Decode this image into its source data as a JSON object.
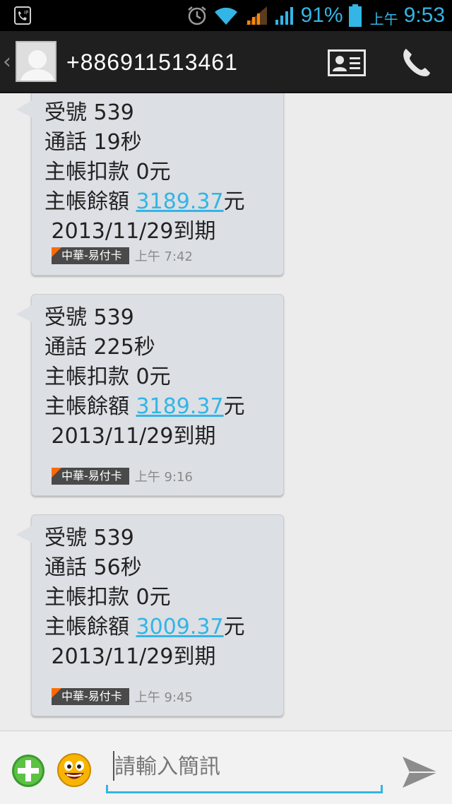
{
  "status_bar": {
    "battery_percent": "91%",
    "clock_prefix": "上午",
    "clock": "9:53",
    "accent": "#33b5e5"
  },
  "header": {
    "contact_number": "+886911513461",
    "avatar_icon": "contact-placeholder-icon",
    "actions": [
      "contact-card-icon",
      "phone-icon"
    ]
  },
  "messages": [
    {
      "line1": "受號 539",
      "line2": "通話 19秒",
      "line3": "主帳扣款 0元",
      "balance_label": "主帳餘額 ",
      "balance_amount": "3189.37",
      "balance_unit": "元",
      "line5": " 2013/11/29到期",
      "sim_label": "中華-易付卡",
      "time": "上午 7:42"
    },
    {
      "line1": "受號 539",
      "line2": "通話 225秒",
      "line3": "主帳扣款 0元",
      "balance_label": "主帳餘額 ",
      "balance_amount": "3189.37",
      "balance_unit": "元",
      "line5": " 2013/11/29到期",
      "sim_label": "中華-易付卡",
      "time": "上午 9:16"
    },
    {
      "line1": "受號 539",
      "line2": "通話 56秒",
      "line3": "主帳扣款 0元",
      "balance_label": "主帳餘額 ",
      "balance_amount": "3009.37",
      "balance_unit": "元",
      "line5": " 2013/11/29到期",
      "sim_label": "中華-易付卡",
      "time": "上午 9:45"
    }
  ],
  "composer": {
    "placeholder": "請輸入簡訊",
    "icons": [
      "add-attachment-icon",
      "emoji-icon",
      "send-icon"
    ]
  }
}
